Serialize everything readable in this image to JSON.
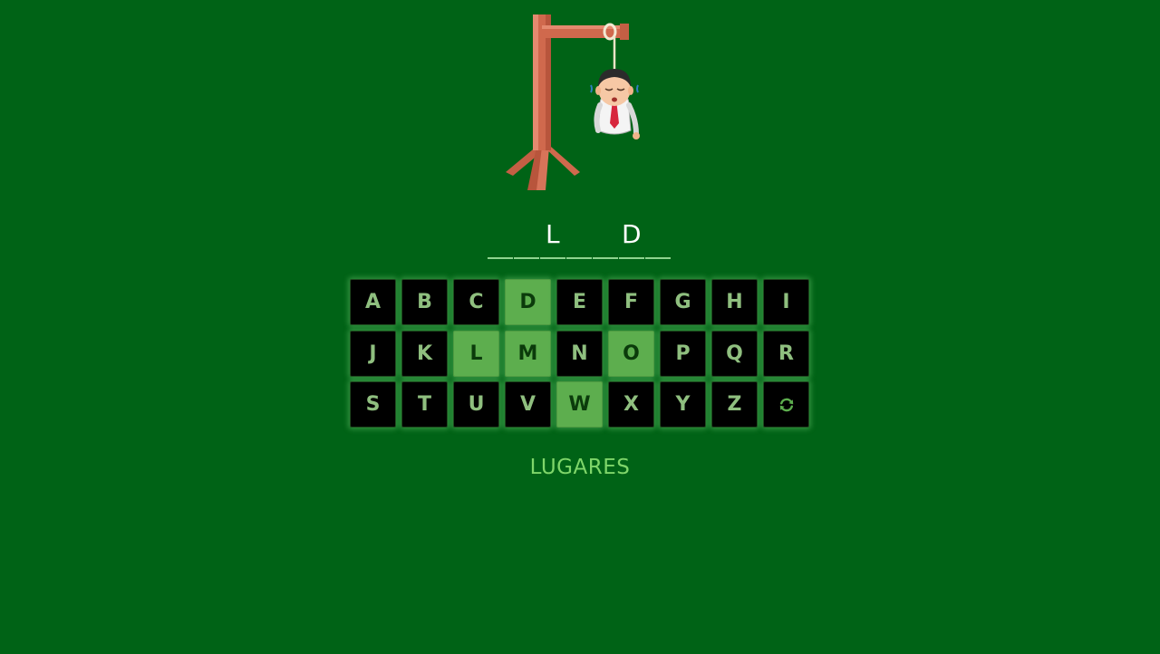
{
  "game": {
    "word_slots": [
      "",
      "",
      "L",
      "",
      "",
      "D",
      ""
    ],
    "keys": [
      {
        "label": "A",
        "used": false
      },
      {
        "label": "B",
        "used": false
      },
      {
        "label": "C",
        "used": false
      },
      {
        "label": "D",
        "used": true
      },
      {
        "label": "E",
        "used": false
      },
      {
        "label": "F",
        "used": false
      },
      {
        "label": "G",
        "used": false
      },
      {
        "label": "H",
        "used": false
      },
      {
        "label": "I",
        "used": false
      },
      {
        "label": "J",
        "used": false
      },
      {
        "label": "K",
        "used": false
      },
      {
        "label": "L",
        "used": true
      },
      {
        "label": "M",
        "used": true
      },
      {
        "label": "N",
        "used": false
      },
      {
        "label": "O",
        "used": true
      },
      {
        "label": "P",
        "used": false
      },
      {
        "label": "Q",
        "used": false
      },
      {
        "label": "R",
        "used": false
      },
      {
        "label": "S",
        "used": false
      },
      {
        "label": "T",
        "used": false
      },
      {
        "label": "U",
        "used": false
      },
      {
        "label": "V",
        "used": false
      },
      {
        "label": "W",
        "used": true
      },
      {
        "label": "X",
        "used": false
      },
      {
        "label": "Y",
        "used": false
      },
      {
        "label": "Z",
        "used": false
      }
    ],
    "reset_icon": "refresh-icon",
    "category": "LUGARES",
    "wrong_guesses_drawn": "head-body-arms",
    "colors": {
      "background": "#006316",
      "key_background": "#000000",
      "key_used": "#5dae4e",
      "key_text": "#8fbf7f",
      "category_text": "#7fd66a",
      "wood": "#d0694d"
    }
  }
}
